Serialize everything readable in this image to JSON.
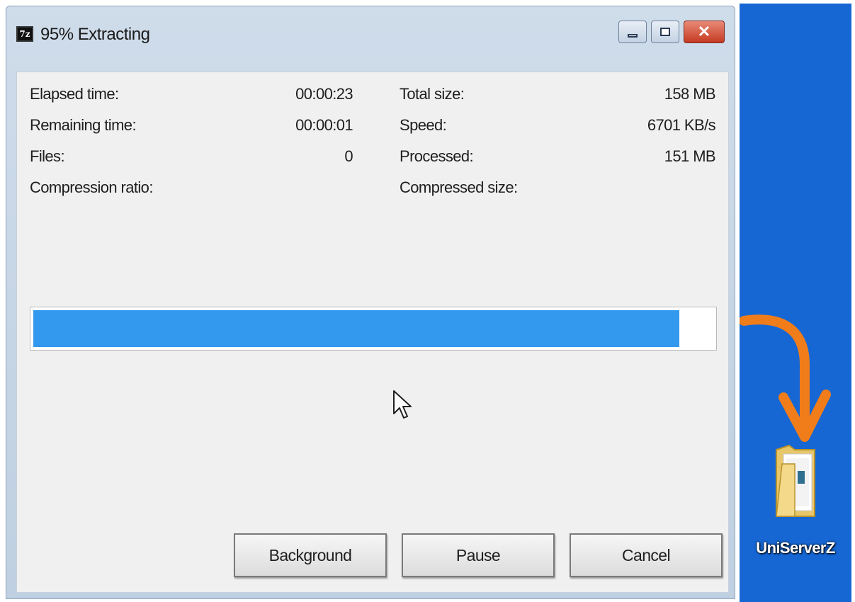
{
  "window": {
    "title": "95% Extracting",
    "app_icon_text": "7z",
    "caption_buttons": {
      "minimize": "minimize-icon",
      "maximize": "maximize-icon",
      "close": "close-icon"
    }
  },
  "stats_left": [
    {
      "label": "Elapsed time:",
      "value": "00:00:23"
    },
    {
      "label": "Remaining time:",
      "value": "00:00:01"
    },
    {
      "label": "Files:",
      "value": "0"
    },
    {
      "label": "Compression ratio:",
      "value": ""
    }
  ],
  "stats_right": [
    {
      "label": "Total size:",
      "value": "158 MB"
    },
    {
      "label": "Speed:",
      "value": "6701 KB/s"
    },
    {
      "label": "Processed:",
      "value": "151 MB"
    },
    {
      "label": "Compressed size:",
      "value": ""
    }
  ],
  "progress": {
    "percent": 95,
    "color": "#3399ee"
  },
  "buttons": {
    "background": "Background",
    "pause": "Pause",
    "cancel": "Cancel"
  },
  "desktop": {
    "background_color": "#1667d4",
    "arrow_color": "#f07d1a",
    "folder_label": "UniServerZ",
    "folder_icon": "folder-icon"
  }
}
